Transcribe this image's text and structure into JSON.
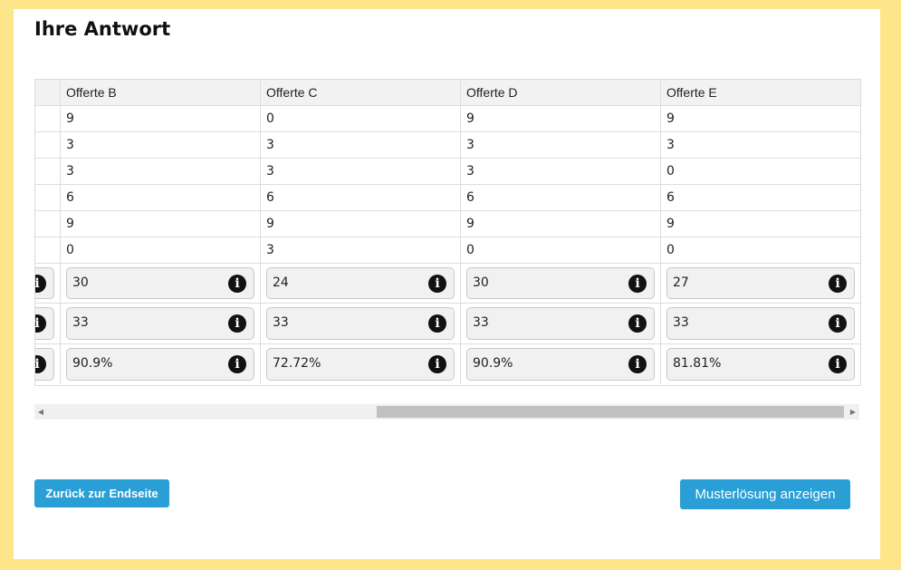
{
  "page": {
    "title": "Ihre Antwort"
  },
  "table": {
    "headers": [
      "",
      "Offerte B",
      "Offerte C",
      "Offerte D",
      "Offerte E"
    ],
    "rows": [
      [
        "9",
        "0",
        "9",
        "9"
      ],
      [
        "3",
        "3",
        "3",
        "3"
      ],
      [
        "3",
        "3",
        "3",
        "0"
      ],
      [
        "6",
        "6",
        "6",
        "6"
      ],
      [
        "9",
        "9",
        "9",
        "9"
      ],
      [
        "0",
        "3",
        "0",
        "0"
      ]
    ],
    "input_rows": [
      [
        "30",
        "24",
        "30",
        "27"
      ],
      [
        "33",
        "33",
        "33",
        "33"
      ],
      [
        "90.9%",
        "72.72%",
        "90.9%",
        "81.81%"
      ]
    ],
    "info_glyph": "i"
  },
  "scrollbar": {
    "left_arrow": "◀",
    "right_arrow": "▶"
  },
  "buttons": {
    "back_label": "Zurück zur Endseite",
    "solution_label": "Musterlösung anzeigen"
  },
  "colors": {
    "page_background": "#fde68a",
    "button": "#2a9fd6"
  },
  "icons": [
    "info-icon",
    "scroll-left-arrow-icon",
    "scroll-right-arrow-icon"
  ]
}
